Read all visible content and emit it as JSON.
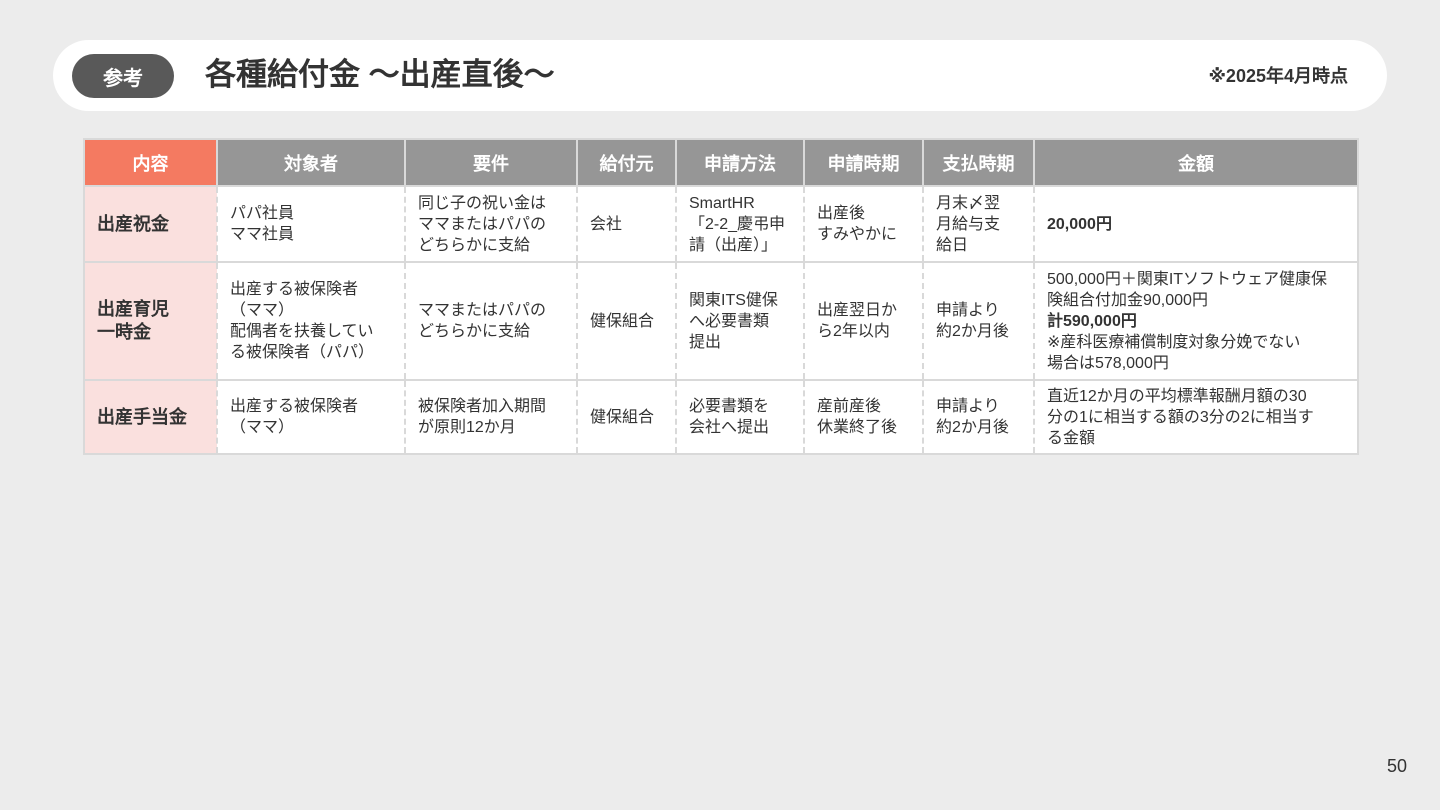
{
  "header": {
    "badge": "参考",
    "title": "各種給付金 ～出産直後～",
    "as_of": "※2025年4月時点"
  },
  "table": {
    "columns": [
      "内容",
      "対象者",
      "要件",
      "給付元",
      "申請方法",
      "申請時期",
      "支払時期",
      "金額"
    ],
    "rows": [
      {
        "name": "出産祝金",
        "target": "パパ社員\nママ社員",
        "requirement": "同じ子の祝い金は\nママまたはパパの\nどちらかに支給",
        "provider": "会社",
        "method": "SmartHR\n「2-2_慶弔申\n請（出産）」",
        "apply_time": "出産後\nすみやかに",
        "pay_time": "月末〆翌\n月給与支\n給日",
        "amount": "20,000円"
      },
      {
        "name": "出産育児\n一時金",
        "target": "出産する被保険者\n（ママ）\n配偶者を扶養してい\nる被保険者（パパ）",
        "requirement": "ママまたはパパの\nどちらかに支給",
        "provider": "健保組合",
        "method": "関東ITS健保\nへ必要書類\n提出",
        "apply_time": "出産翌日か\nら2年以内",
        "pay_time": "申請より\n約2か月後",
        "amount_line1": "500,000円＋関東ITソフトウェア健康保\n険組合付加金90,000円",
        "amount_total": "計590,000円",
        "amount_note": "※産科医療補償制度対象分娩でない\n場合は578,000円"
      },
      {
        "name": "出産手当金",
        "target": "出産する被保険者\n（ママ）",
        "requirement": "被保険者加入期間\nが原則12か月",
        "provider": "健保組合",
        "method": "必要書類を\n会社へ提出",
        "apply_time": "産前産後\n休業終了後",
        "pay_time": "申請より\n約2か月後",
        "amount": "直近12か月の平均標準報酬月額の30\n分の1に相当する額の3分の2に相当す\nる金額"
      }
    ]
  },
  "page_number": "50",
  "colors": {
    "background": "#ececec",
    "badge": "#595959",
    "header_first_col": "#f47a61",
    "header_col": "#969696",
    "row_label_bg": "#fae0de"
  }
}
